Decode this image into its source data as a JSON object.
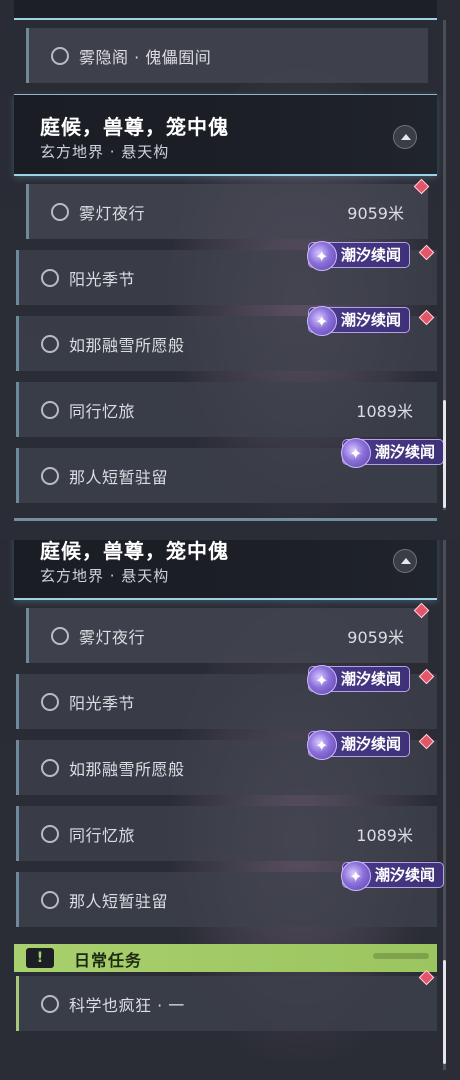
{
  "panel_top": {
    "prev_item": "雾隐阁 · 傀儡囿间",
    "group": {
      "title": "庭候，兽尊，笼中傀",
      "subtitle": "玄方地界 · 悬天构"
    },
    "items": [
      {
        "label": "雾灯夜行",
        "distance": "9059米"
      },
      {
        "label": "阳光季节"
      },
      {
        "label": "如那融雪所愿般"
      },
      {
        "label": "同行忆旅",
        "distance": "1089米"
      },
      {
        "label": "那人短暂驻留"
      }
    ],
    "badges": [
      "潮汐续闻",
      "潮汐续闻",
      "潮汐续闻"
    ]
  },
  "panel_bottom": {
    "group": {
      "title": "庭候，兽尊，笼中傀",
      "subtitle": "玄方地界 · 悬天构"
    },
    "items": [
      {
        "label": "雾灯夜行",
        "distance": "9059米"
      },
      {
        "label": "阳光季节"
      },
      {
        "label": "如那融雪所愿般"
      },
      {
        "label": "同行忆旅",
        "distance": "1089米"
      },
      {
        "label": "那人短暂驻留"
      }
    ],
    "badges": [
      "潮汐续闻",
      "潮汐续闻",
      "潮汐续闻"
    ],
    "daily": {
      "header": "日常任务",
      "icon_text": "!",
      "items": [
        {
          "label": "科学也疯狂 · 一"
        }
      ]
    }
  },
  "colors": {
    "accent_cyan": "#9ed2e6",
    "badge_purple": "#4a3a8a",
    "daily_green": "#a8d06e",
    "tracked_red": "#e4556a"
  },
  "icons": {
    "collapse": "chevron-up-icon",
    "quest_status": "circle-icon",
    "badge": "tidal-star-icon",
    "tracked": "diamond-marker-icon",
    "daily": "exclamation-icon"
  }
}
